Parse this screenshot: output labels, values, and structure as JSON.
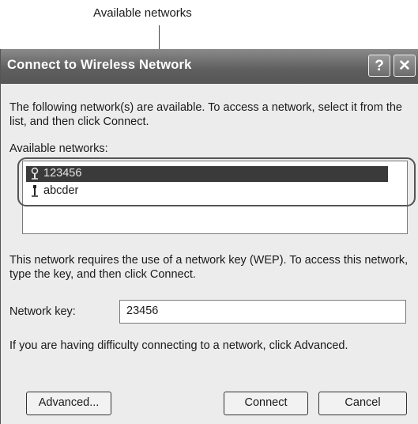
{
  "callout": {
    "label": "Available networks"
  },
  "window": {
    "title": "Connect to Wireless Network",
    "help_glyph": "?",
    "close_glyph": "✕"
  },
  "intro_text": "The following network(s) are available. To access a network, select it from the list, and then click Connect.",
  "available_label": "Available networks:",
  "networks": [
    {
      "name": "123456",
      "icon": "access-point-icon",
      "selected": true
    },
    {
      "name": "abcder",
      "icon": "computer-to-computer-icon",
      "selected": false
    }
  ],
  "wep_text": "This network requires the use of a network key (WEP). To access this network, type the key, and then click Connect.",
  "key_label": "Network key:",
  "key_value": "23456",
  "difficulty_text": "If you are having difficulty connecting to a network, click Advanced.",
  "buttons": {
    "advanced": "Advanced...",
    "connect": "Connect",
    "cancel": "Cancel"
  }
}
